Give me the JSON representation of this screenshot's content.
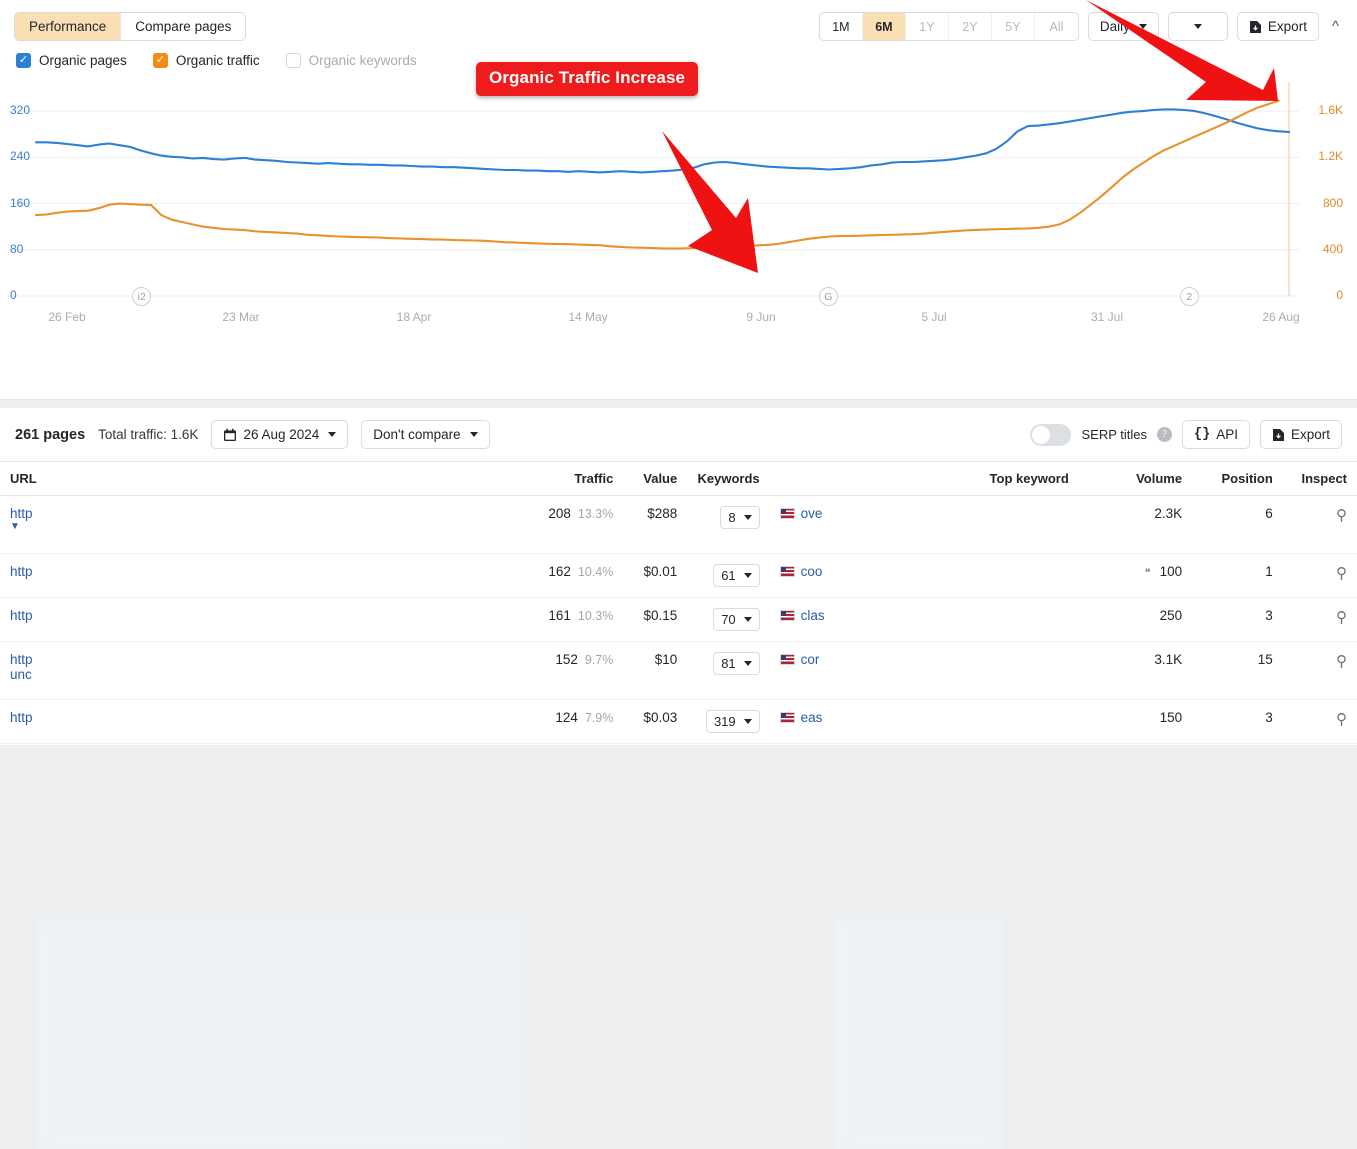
{
  "chart_panel": {
    "tabs": [
      {
        "label": "Performance",
        "active": true
      },
      {
        "label": "Compare pages",
        "active": false
      }
    ],
    "ranges": [
      {
        "label": "1M",
        "active": false,
        "dim": false
      },
      {
        "label": "6M",
        "active": true,
        "dim": false
      },
      {
        "label": "1Y",
        "active": false,
        "dim": true
      },
      {
        "label": "2Y",
        "active": false,
        "dim": true
      },
      {
        "label": "5Y",
        "active": false,
        "dim": true
      },
      {
        "label": "All",
        "active": false,
        "dim": true
      }
    ],
    "granularity": "Daily",
    "export_label": "Export",
    "collapse_icon": "chevron-up-icon",
    "legend": [
      {
        "label": "Organic pages",
        "checked": true,
        "color": "#2d7fd3",
        "dim": false
      },
      {
        "label": "Organic traffic",
        "checked": true,
        "color": "#f28c16",
        "dim": false
      },
      {
        "label": "Organic keywords",
        "checked": false,
        "color": "#ffffff",
        "dim": true
      }
    ],
    "annotation": {
      "callout_text": "Organic Traffic Increase",
      "callout_color": "#ee1c1c",
      "arrows": 2
    },
    "event_markers": [
      {
        "label": "i2",
        "x_pct": 8.4
      },
      {
        "label": "G",
        "x_pct": 63.2
      },
      {
        "label": "2",
        "x_pct": 92.0
      }
    ]
  },
  "chart_data": {
    "type": "line",
    "title": "",
    "xlabel": "",
    "ylabel": "Organic pages",
    "y2label": "Organic traffic",
    "grid": true,
    "legend_position": "top-left",
    "x_tick_labels": [
      "26 Feb",
      "23 Mar",
      "18 Apr",
      "14 May",
      "9 Jun",
      "5 Jul",
      "31 Jul",
      "26 Aug"
    ],
    "y_left_ticks": [
      0,
      80,
      160,
      240,
      320
    ],
    "y_left_lim": [
      0,
      360
    ],
    "y_left_color": "#3f7fcc",
    "y_right_ticks": [
      "0",
      "400",
      "800",
      "1.2K",
      "1.6K"
    ],
    "y_right_values": [
      0,
      400,
      800,
      1200,
      1600
    ],
    "y_right_lim": [
      0,
      1800
    ],
    "y_right_color": "#e08b29",
    "series": [
      {
        "name": "Organic pages",
        "color": "#2d7fd3",
        "axis": "left",
        "values": [
          266,
          266,
          265,
          263,
          261,
          259,
          262,
          264,
          261,
          258,
          252,
          247,
          243,
          241,
          240,
          238,
          239,
          237,
          236,
          238,
          239,
          236,
          235,
          234,
          232,
          231,
          230,
          229,
          230,
          229,
          228,
          228,
          227,
          227,
          226,
          226,
          225,
          224,
          224,
          223,
          223,
          222,
          221,
          220,
          219,
          218,
          218,
          217,
          217,
          216,
          216,
          215,
          216,
          215,
          214,
          215,
          216,
          215,
          214,
          215,
          216,
          217,
          219,
          222,
          228,
          231,
          232,
          230,
          228,
          226,
          224,
          223,
          222,
          221,
          221,
          220,
          219,
          220,
          221,
          223,
          226,
          228,
          231,
          232,
          232,
          233,
          234,
          235,
          237,
          240,
          243,
          247,
          255,
          268,
          285,
          294,
          295,
          297,
          299,
          302,
          305,
          308,
          311,
          314,
          317,
          319,
          320,
          322,
          323,
          323,
          322,
          320,
          316,
          311,
          306,
          300,
          295,
          290,
          287,
          285,
          284
        ]
      },
      {
        "name": "Organic traffic",
        "color": "#e8912d",
        "axis": "right",
        "values": [
          700,
          705,
          720,
          730,
          735,
          738,
          760,
          790,
          800,
          795,
          790,
          788,
          700,
          660,
          640,
          620,
          600,
          590,
          580,
          575,
          570,
          560,
          555,
          550,
          545,
          540,
          530,
          525,
          520,
          515,
          512,
          510,
          508,
          505,
          500,
          498,
          495,
          492,
          490,
          488,
          485,
          482,
          480,
          478,
          472,
          465,
          462,
          458,
          455,
          452,
          450,
          448,
          445,
          442,
          440,
          430,
          425,
          420,
          418,
          415,
          412,
          410,
          412,
          415,
          420,
          425,
          430,
          432,
          435,
          438,
          442,
          450,
          465,
          480,
          495,
          505,
          515,
          518,
          520,
          522,
          525,
          528,
          530,
          532,
          535,
          540,
          548,
          555,
          562,
          568,
          572,
          575,
          578,
          580,
          582,
          585,
          590,
          600,
          620,
          660,
          720,
          790,
          860,
          940,
          1020,
          1090,
          1150,
          1210,
          1260,
          1300,
          1340,
          1380,
          1420,
          1460,
          1500,
          1545,
          1590,
          1630,
          1660,
          1690
        ]
      }
    ]
  },
  "table_panel": {
    "pages_count": "261 pages",
    "total_traffic": "Total traffic: 1.6K",
    "date_picker": "26 Aug 2024",
    "date_picker_icon": "calendar-icon",
    "compare_label": "Don't compare",
    "serp_titles_label": "SERP titles",
    "serp_titles_on": false,
    "api_label": "API",
    "export_label": "Export",
    "columns": [
      "URL",
      "Traffic",
      "Value",
      "Keywords",
      "Top keyword",
      "Volume",
      "Position",
      "Inspect"
    ],
    "rows": [
      {
        "url": "http",
        "url_second_line": "",
        "has_expand_caret": true,
        "traffic": "208",
        "traffic_pct": "13.3%",
        "value": "$288",
        "keywords": "8",
        "top_keyword": "ove",
        "country": "US",
        "volume": "2.3K",
        "position": "6",
        "has_snippet_icon": false
      },
      {
        "url": "http",
        "url_second_line": "",
        "has_expand_caret": false,
        "traffic": "162",
        "traffic_pct": "10.4%",
        "value": "$0.01",
        "keywords": "61",
        "top_keyword": "coo",
        "country": "US",
        "volume": "100",
        "position": "1",
        "has_snippet_icon": true
      },
      {
        "url": "http",
        "url_second_line": "",
        "has_expand_caret": false,
        "traffic": "161",
        "traffic_pct": "10.3%",
        "value": "$0.15",
        "keywords": "70",
        "top_keyword": "clas",
        "country": "US",
        "volume": "250",
        "position": "3",
        "has_snippet_icon": false
      },
      {
        "url": "http",
        "url_second_line": "unc",
        "has_expand_caret": false,
        "traffic": "152",
        "traffic_pct": "9.7%",
        "value": "$10",
        "keywords": "81",
        "top_keyword": "cor",
        "country": "US",
        "volume": "3.1K",
        "position": "15",
        "has_snippet_icon": false
      },
      {
        "url": "http",
        "url_second_line": "",
        "has_expand_caret": false,
        "traffic": "124",
        "traffic_pct": "7.9%",
        "value": "$0.03",
        "keywords": "319",
        "top_keyword": "eas",
        "country": "US",
        "volume": "150",
        "position": "3",
        "has_snippet_icon": false
      }
    ]
  }
}
